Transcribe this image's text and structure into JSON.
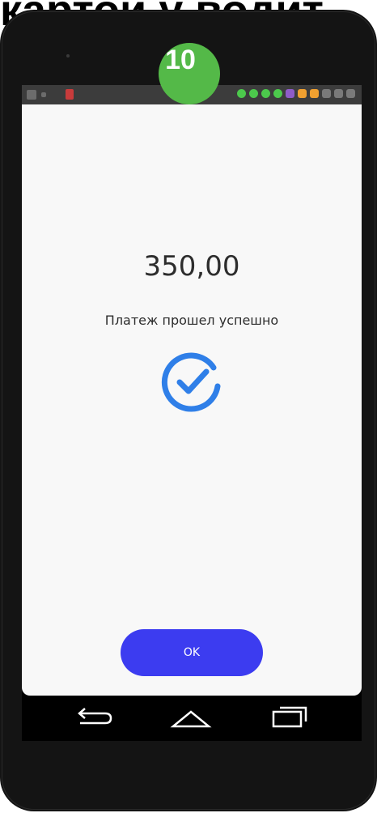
{
  "slide": {
    "heading_fragment": "картой у водит"
  },
  "step_badge": {
    "number": "10",
    "color": "#54b948"
  },
  "status_bar": {
    "background": "#3c3c3c",
    "left_icons": [
      "wifi-icon",
      "signal-icon",
      "app-notification-icon"
    ],
    "right_icons": [
      "green-app-icon",
      "green-app-icon",
      "green-app-icon",
      "green-app-icon",
      "viber-icon",
      "orange-app-icon",
      "orange-app-icon",
      "headphones-icon",
      "alarm-icon",
      "bluetooth-icon"
    ],
    "right_icon_colors": [
      "#4cc94c",
      "#4cc94c",
      "#4cc94c",
      "#4cc94c",
      "#8e5cc8",
      "#f0a030",
      "#f0a030",
      "#7a7a7a",
      "#7a7a7a",
      "#7a7a7a"
    ]
  },
  "payment": {
    "amount": "350,00",
    "status_text": "Платеж прошел успешно",
    "success_icon": "check-circle-icon",
    "success_color": "#2f7fe8"
  },
  "actions": {
    "ok_label": "OK",
    "ok_color": "#3c3cf0"
  },
  "nav_bar": {
    "back_icon": "back-arrow-icon",
    "home_icon": "home-icon",
    "recents_icon": "recents-icon"
  }
}
